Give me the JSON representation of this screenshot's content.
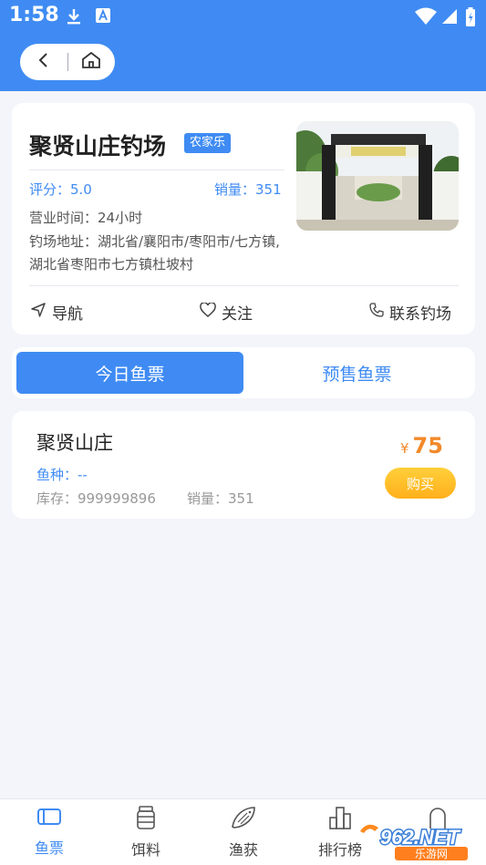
{
  "status_bar": {
    "time": "1:58",
    "icons": [
      "download-icon",
      "a-badge-icon",
      "wifi-icon",
      "signal-icon",
      "battery-icon"
    ]
  },
  "header": {
    "back_icon": "chevron-left-icon",
    "home_icon": "home-icon"
  },
  "venue": {
    "name": "聚贤山庄钓场",
    "tag": "农家乐",
    "rating": "评分：5.0",
    "sales": "销量：351",
    "hours": "营业时间：24小时",
    "address": "钓场地址：湖北省/襄阳市/枣阳市/七方镇,湖北省枣阳市七方镇杜坡村",
    "actions": {
      "navigate": "导航",
      "follow": "关注",
      "contact": "联系钓场"
    }
  },
  "tabs": {
    "today": "今日鱼票",
    "presale": "预售鱼票"
  },
  "ticket": {
    "name": "聚贤山庄",
    "species": "鱼种：--",
    "stock": "库存：999999896",
    "sales": "销量：351",
    "currency": "¥",
    "price": "75",
    "buy_label": "购买"
  },
  "bottom_nav": [
    {
      "label": "鱼票",
      "icon": "ticket-icon",
      "active": true
    },
    {
      "label": "饵料",
      "icon": "bait-jar-icon",
      "active": false
    },
    {
      "label": "渔获",
      "icon": "fish-icon",
      "active": false
    },
    {
      "label": "排行榜",
      "icon": "bar-chart-icon",
      "active": false
    },
    {
      "label": "",
      "icon": "user-icon",
      "active": false
    }
  ],
  "watermark": {
    "line1": "962.NET",
    "line2": "乐游网"
  },
  "colors": {
    "primary": "#3f8bf3",
    "price": "#f28a2a",
    "buy_button": "#ffb01c",
    "background": "#f3f5fa"
  }
}
